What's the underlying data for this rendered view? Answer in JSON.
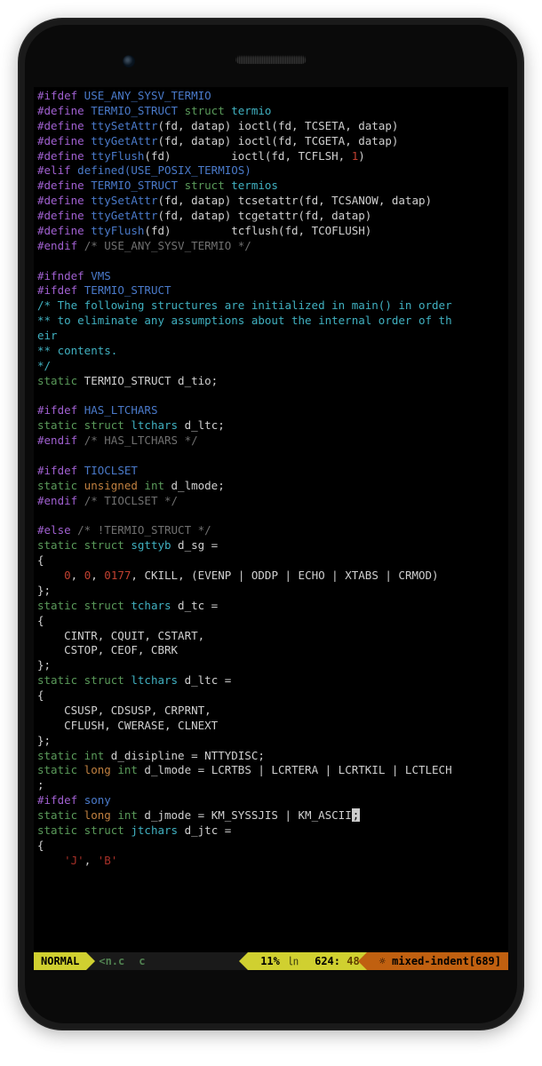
{
  "code_lines": [
    [
      [
        "purple",
        "#ifdef"
      ],
      [
        "blue",
        " USE_ANY_SYSV_TERMIO"
      ]
    ],
    [
      [
        "purple",
        "#define"
      ],
      [
        "blue",
        " TERMIO_STRUCT "
      ],
      [
        "green",
        "struct"
      ],
      [
        "cyan",
        " termio"
      ]
    ],
    [
      [
        "purple",
        "#define"
      ],
      [
        "blue",
        " ttySetAttr"
      ],
      [
        "white",
        "(fd, datap) ioctl(fd, TCSETA, datap)"
      ]
    ],
    [
      [
        "purple",
        "#define"
      ],
      [
        "blue",
        " ttyGetAttr"
      ],
      [
        "white",
        "(fd, datap) ioctl(fd, TCGETA, datap)"
      ]
    ],
    [
      [
        "purple",
        "#define"
      ],
      [
        "blue",
        " ttyFlush"
      ],
      [
        "white",
        "(fd)         ioctl(fd, TCFLSH, "
      ],
      [
        "red",
        "1"
      ],
      [
        "white",
        ")"
      ]
    ],
    [
      [
        "purple",
        "#elif"
      ],
      [
        "blue",
        " defined(USE_POSIX_TERMIOS)"
      ]
    ],
    [
      [
        "purple",
        "#define"
      ],
      [
        "blue",
        " TERMIO_STRUCT "
      ],
      [
        "green",
        "struct"
      ],
      [
        "cyan",
        " termios"
      ]
    ],
    [
      [
        "purple",
        "#define"
      ],
      [
        "blue",
        " ttySetAttr"
      ],
      [
        "white",
        "(fd, datap) tcsetattr(fd, TCSANOW, datap)"
      ]
    ],
    [
      [
        "purple",
        "#define"
      ],
      [
        "blue",
        " ttyGetAttr"
      ],
      [
        "white",
        "(fd, datap) tcgetattr(fd, datap)"
      ]
    ],
    [
      [
        "purple",
        "#define"
      ],
      [
        "blue",
        " ttyFlush"
      ],
      [
        "white",
        "(fd)         tcflush(fd, TCOFLUSH)"
      ]
    ],
    [
      [
        "purple",
        "#endif "
      ],
      [
        "gray",
        "/* USE_ANY_SYSV_TERMIO */"
      ]
    ],
    [
      [
        "white",
        ""
      ]
    ],
    [
      [
        "purple",
        "#ifndef "
      ],
      [
        "blue",
        "VMS"
      ]
    ],
    [
      [
        "purple",
        "#ifdef "
      ],
      [
        "blue",
        "TERMIO_STRUCT"
      ]
    ],
    [
      [
        "cyan",
        "/* The following structures are initialized in main() in order"
      ]
    ],
    [
      [
        "cyan",
        "** to eliminate any assumptions about the internal order of th"
      ]
    ],
    [
      [
        "cyan",
        "eir"
      ]
    ],
    [
      [
        "cyan",
        "** contents."
      ]
    ],
    [
      [
        "cyan",
        "*/"
      ]
    ],
    [
      [
        "green",
        "static"
      ],
      [
        "white",
        " TERMIO_STRUCT d_tio;"
      ]
    ],
    [
      [
        "white",
        ""
      ]
    ],
    [
      [
        "purple",
        "#ifdef "
      ],
      [
        "blue",
        "HAS_LTCHARS"
      ]
    ],
    [
      [
        "green",
        "static"
      ],
      [
        "green",
        " struct"
      ],
      [
        "cyan",
        " ltchars"
      ],
      [
        "white",
        " d_ltc;"
      ]
    ],
    [
      [
        "purple",
        "#endif "
      ],
      [
        "gray",
        "/* HAS_LTCHARS */"
      ]
    ],
    [
      [
        "white",
        ""
      ]
    ],
    [
      [
        "purple",
        "#ifdef "
      ],
      [
        "blue",
        "TIOCLSET"
      ]
    ],
    [
      [
        "green",
        "static"
      ],
      [
        "orange",
        " unsigned"
      ],
      [
        "green",
        " int"
      ],
      [
        "white",
        " d_lmode;"
      ]
    ],
    [
      [
        "purple",
        "#endif "
      ],
      [
        "gray",
        "/* TIOCLSET */"
      ]
    ],
    [
      [
        "white",
        ""
      ]
    ],
    [
      [
        "purple",
        "#else "
      ],
      [
        "gray",
        "/* !TERMIO_STRUCT */"
      ]
    ],
    [
      [
        "green",
        "static"
      ],
      [
        "green",
        " struct"
      ],
      [
        "cyan",
        " sgttyb"
      ],
      [
        "white",
        " d_sg ="
      ]
    ],
    [
      [
        "white",
        "{"
      ]
    ],
    [
      [
        "white",
        "    "
      ],
      [
        "red",
        "0"
      ],
      [
        "white",
        ", "
      ],
      [
        "red",
        "0"
      ],
      [
        "white",
        ", "
      ],
      [
        "red",
        "0177"
      ],
      [
        "white",
        ", CKILL, (EVENP | ODDP | ECHO | XTABS | CRMOD)"
      ]
    ],
    [
      [
        "white",
        "};"
      ]
    ],
    [
      [
        "green",
        "static"
      ],
      [
        "green",
        " struct"
      ],
      [
        "cyan",
        " tchars"
      ],
      [
        "white",
        " d_tc ="
      ]
    ],
    [
      [
        "white",
        "{"
      ]
    ],
    [
      [
        "white",
        "    CINTR, CQUIT, CSTART,"
      ]
    ],
    [
      [
        "white",
        "    CSTOP, CEOF, CBRK"
      ]
    ],
    [
      [
        "white",
        "};"
      ]
    ],
    [
      [
        "green",
        "static"
      ],
      [
        "green",
        " struct"
      ],
      [
        "cyan",
        " ltchars"
      ],
      [
        "white",
        " d_ltc ="
      ]
    ],
    [
      [
        "white",
        "{"
      ]
    ],
    [
      [
        "white",
        "    CSUSP, CDSUSP, CRPRNT,"
      ]
    ],
    [
      [
        "white",
        "    CFLUSH, CWERASE, CLNEXT"
      ]
    ],
    [
      [
        "white",
        "};"
      ]
    ],
    [
      [
        "green",
        "static"
      ],
      [
        "green",
        " int"
      ],
      [
        "white",
        " d_disipline = NTTYDISC;"
      ]
    ],
    [
      [
        "green",
        "static"
      ],
      [
        "orange",
        " long"
      ],
      [
        "green",
        " int"
      ],
      [
        "white",
        " d_lmode = LCRTBS | LCRTERA | LCRTKIL | LCTLECH"
      ]
    ],
    [
      [
        "white",
        ";"
      ]
    ],
    [
      [
        "purple",
        "#ifdef "
      ],
      [
        "blue",
        "sony"
      ]
    ],
    [
      [
        "green",
        "static"
      ],
      [
        "orange",
        " long"
      ],
      [
        "green",
        " int"
      ],
      [
        "white",
        " d_jmode = KM_SYSSJIS | KM_ASCII"
      ],
      [
        "cursor-block",
        ";"
      ]
    ],
    [
      [
        "green",
        "static"
      ],
      [
        "green",
        " struct"
      ],
      [
        "cyan",
        " jtchars"
      ],
      [
        "white",
        " d_jtc ="
      ]
    ],
    [
      [
        "white",
        "{"
      ]
    ],
    [
      [
        "white",
        "    "
      ],
      [
        "darkred",
        "'J'"
      ],
      [
        "white",
        ", "
      ],
      [
        "darkred",
        "'B'"
      ]
    ]
  ],
  "status": {
    "mode": " NORMAL ",
    "filename": "<n.c",
    "filetype": "c",
    "percent": "11%",
    "line": "624",
    "col": "48",
    "warning": "☼ mixed-indent[689]"
  }
}
